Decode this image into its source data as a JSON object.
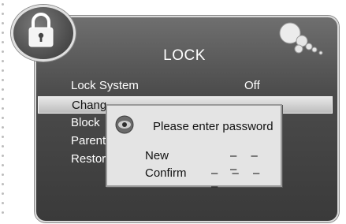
{
  "title": "LOCK",
  "menu": [
    {
      "label": "Lock System",
      "value": "Off"
    },
    {
      "label": "Chang"
    },
    {
      "label": "Block"
    },
    {
      "label": "Parent"
    },
    {
      "label": "Restor"
    }
  ],
  "dialog": {
    "prompt": "Please  enter password",
    "new_label": "New",
    "new_value": "– – –",
    "confirm_label": "Confirm",
    "confirm_value": "– – – –"
  },
  "colors": {
    "panel": "#4b4b4b",
    "dialog": "#e4e4e4",
    "highlight": "#d0d0d0",
    "text_light": "#ffffff"
  },
  "icons": [
    "padlock-icon",
    "bubbles-icon",
    "eye-icon"
  ]
}
